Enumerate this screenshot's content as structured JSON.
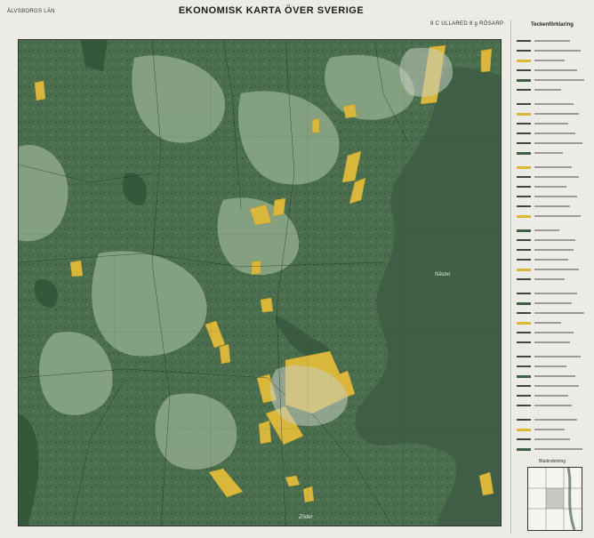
{
  "header": {
    "title": "EKONOMISK KARTA ÖVER SVERIGE",
    "county": "ÄLVSBORGS LÄN",
    "sheet_id": "8 C ULLARED 8 g RÖSARP"
  },
  "legend": {
    "title": "Teckenförklaring"
  },
  "overview": {
    "label": "Bladindelning"
  },
  "map": {
    "lake_label": "Näsbo",
    "place_labels": [
      "Zöder"
    ],
    "colors": {
      "forest": "#4a6e4e",
      "forest_dark": "#2e5235",
      "clearing": "#8ea98a",
      "water": "#3f5e45",
      "farmland": "#d9b73a",
      "paper": "#ecebe5"
    }
  }
}
